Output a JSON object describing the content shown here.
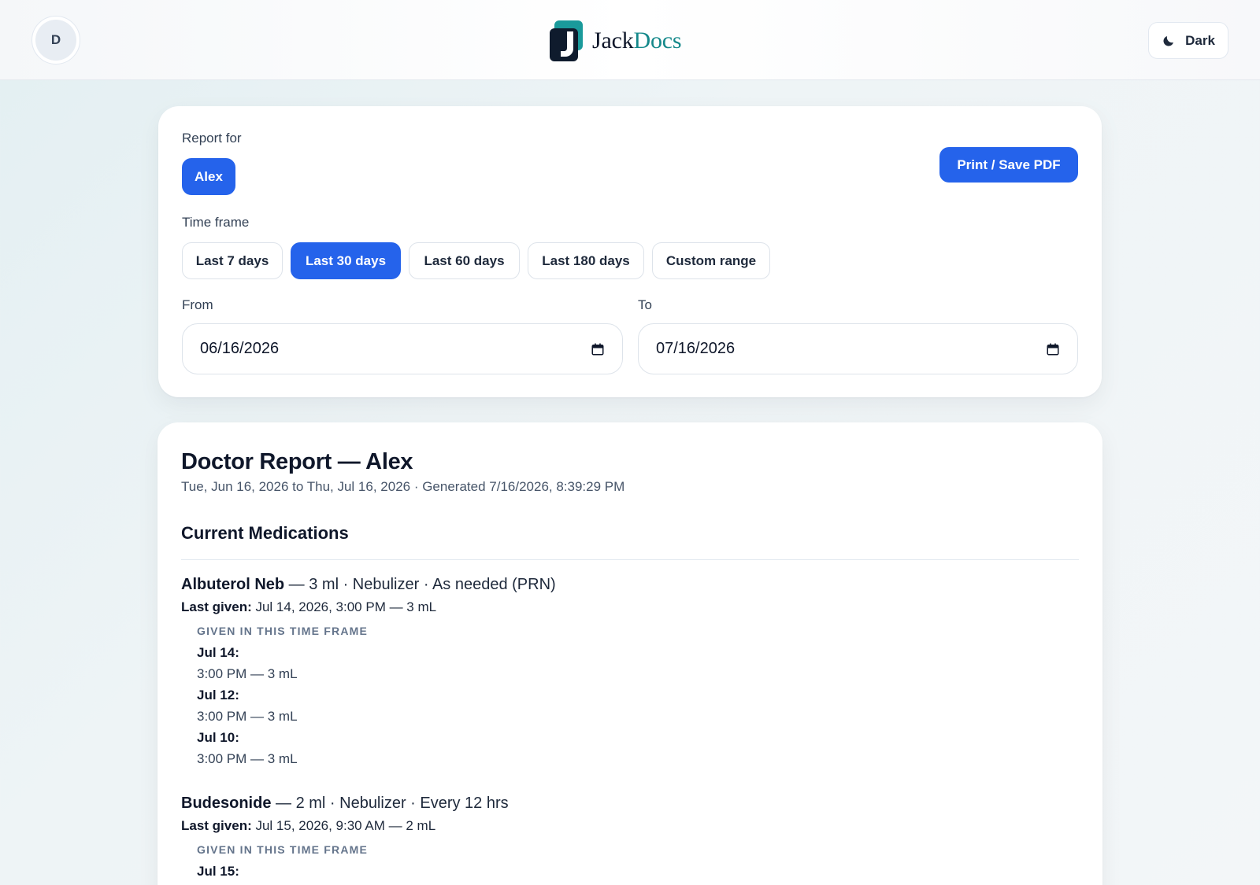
{
  "header": {
    "avatar_initial": "D",
    "brand_first": "Jack",
    "brand_second": "Docs",
    "theme_toggle_label": "Dark"
  },
  "controls": {
    "report_for_label": "Report for",
    "patients": [
      {
        "label": "Alex",
        "selected": true
      }
    ],
    "print_label": "Print / Save PDF",
    "time_frame_label": "Time frame",
    "time_frames": [
      {
        "label": "Last 7 days",
        "selected": false
      },
      {
        "label": "Last 30 days",
        "selected": true
      },
      {
        "label": "Last 60 days",
        "selected": false
      },
      {
        "label": "Last 180 days",
        "selected": false
      },
      {
        "label": "Custom range",
        "selected": false
      }
    ],
    "from_label": "From",
    "from_value": "06/16/2026",
    "to_label": "To",
    "to_value": "07/16/2026"
  },
  "report": {
    "title": "Doctor Report — Alex",
    "subtitle": "Tue, Jun 16, 2026 to Thu, Jul 16, 2026 · Generated 7/16/2026, 8:39:29 PM",
    "section_title": "Current Medications",
    "last_given_label": "Last given:",
    "given_label": "GIVEN IN THIS TIME FRAME",
    "medications": [
      {
        "name": "Albuterol Neb",
        "details": " — 3 ml · Nebulizer · As needed (PRN)",
        "last_given": " Jul 14, 2026, 3:00 PM — 3 mL",
        "doses": [
          {
            "day": "Jul 14:",
            "time": "3:00 PM — 3 mL"
          },
          {
            "day": "Jul 12:",
            "time": "3:00 PM — 3 mL"
          },
          {
            "day": "Jul 10:",
            "time": "3:00 PM — 3 mL"
          }
        ]
      },
      {
        "name": "Budesonide",
        "details": " — 2 ml · Nebulizer · Every 12 hrs",
        "last_given": " Jul 15, 2026, 9:30 AM — 2 mL",
        "doses": [
          {
            "day": "Jul 15:",
            "time": ""
          }
        ]
      }
    ]
  },
  "colors": {
    "primary": "#2563eb",
    "brand_teal": "#14888a",
    "text_dark": "#0f172a"
  }
}
